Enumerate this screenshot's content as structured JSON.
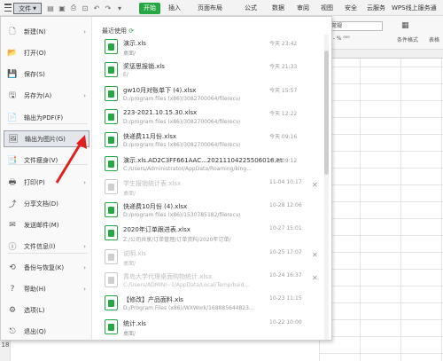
{
  "toolbar": {
    "file_label": "文件",
    "tabs": [
      "开始",
      "插入",
      "页面布局",
      "公式",
      "数据",
      "审阅",
      "视图",
      "安全",
      "云服务",
      "WPS线上服务通"
    ]
  },
  "ribbon": {
    "number_format": "常规",
    "conditional_format": "条件格式",
    "table_style": "表格"
  },
  "sidebar": {
    "items": [
      {
        "label": "新建(N)",
        "icon": "new-file-icon",
        "arrow": "›"
      },
      {
        "label": "打开(O)",
        "icon": "open-folder-icon",
        "arrow": ""
      },
      {
        "label": "保存(S)",
        "icon": "save-icon",
        "arrow": ""
      },
      {
        "label": "另存为(A)",
        "icon": "save-as-icon",
        "arrow": "›"
      },
      {
        "label": "输出为PDF(F)",
        "icon": "pdf-icon",
        "arrow": ""
      },
      {
        "label": "输出为图片(G)",
        "icon": "image-icon",
        "arrow": ""
      },
      {
        "label": "文件瘦身(V)",
        "icon": "slim-icon",
        "arrow": ""
      },
      {
        "label": "打印(P)",
        "icon": "print-icon",
        "arrow": "›"
      },
      {
        "label": "分享文档(D)",
        "icon": "share-icon",
        "arrow": ""
      },
      {
        "label": "发送邮件(M)",
        "icon": "mail-icon",
        "arrow": ""
      },
      {
        "label": "文件信息(I)",
        "icon": "info-icon",
        "arrow": "›"
      },
      {
        "label": "备份与恢复(K)",
        "icon": "backup-icon",
        "arrow": "›"
      },
      {
        "label": "帮助(H)",
        "icon": "help-icon",
        "arrow": "›"
      },
      {
        "label": "选项(L)",
        "icon": "options-icon",
        "arrow": ""
      },
      {
        "label": "退出(Q)",
        "icon": "exit-icon",
        "arrow": ""
      }
    ]
  },
  "recent": {
    "title": "最近使用",
    "files": [
      {
        "name": "演示.xls",
        "path": "桌面/",
        "time": "今天 23:42",
        "dim": false,
        "close": ""
      },
      {
        "name": "奖惩思报销.xls",
        "path": "E/",
        "time": "今天 21:33",
        "dim": false,
        "close": ""
      },
      {
        "name": "gw10月对账单下 (4).xlsx",
        "path": "D:/program files (x86)/3082700064/filerecv/",
        "time": "今天 15:57",
        "dim": false,
        "close": ""
      },
      {
        "name": "223-2021.10.15.30.xlsx",
        "path": "D:/program files (x86)/3082700064/filerecv/",
        "time": "今天 12:22",
        "dim": false,
        "close": ""
      },
      {
        "name": "快递费11月份.xlsx",
        "path": "D:/program files (x86)/3082700064/filerecv/",
        "time": "今天 09:16",
        "dim": false,
        "close": ""
      },
      {
        "name": "演示.xls.AD2C3FF661AAC...20211104225506016.et",
        "path": "C:/Users/Administrator/AppData/Roaming/king...",
        "time": "今天 09:12",
        "dim": false,
        "close": ""
      },
      {
        "name": "学生报销统计表.xlsx",
        "path": "桌面/",
        "time": "11-04 10:17",
        "dim": true,
        "close": "✕"
      },
      {
        "name": "快递费10月份 (4).xlsx",
        "path": "D:/program files (x86)/1530785182/filerecv/",
        "time": "10-28 12:06",
        "dim": false,
        "close": ""
      },
      {
        "name": "2020年订单跟进表.xlsx",
        "path": "Z:/公司共享/订单管理/订单资料/2020年订单/",
        "time": "10-27 15:01",
        "dim": false,
        "close": ""
      },
      {
        "name": "说明.xls",
        "path": "桌面/",
        "time": "10-25 17:07",
        "dim": true,
        "close": "✕"
      },
      {
        "name": "青岛大学代理桌面购物统计.xlsx",
        "path": "C:/Users/ADMINI~1/AppData/Local/Temp/baid...",
        "time": "10-24 16:37",
        "dim": true,
        "close": "✕"
      },
      {
        "name": "【修改】产品面料.xls",
        "path": "D:/Program Files (x86)/WXWork/168885644823...",
        "time": "10-23 11:15",
        "dim": false,
        "close": ""
      },
      {
        "name": "统计.xls",
        "path": "桌面/",
        "time": "10-22 10:00",
        "dim": false,
        "close": ""
      }
    ]
  },
  "sheet": {
    "row_number": "18"
  },
  "colors": {
    "accent": "#27a644",
    "arrow": "#e02020"
  }
}
